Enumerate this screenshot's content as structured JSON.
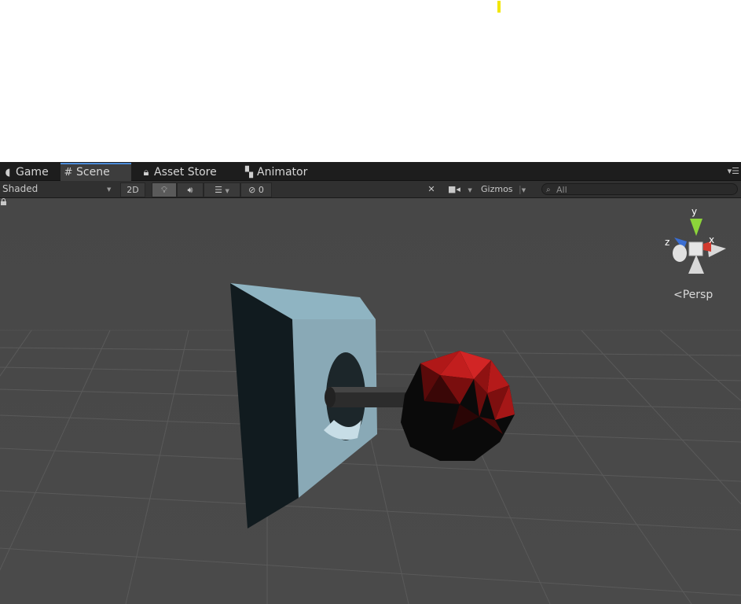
{
  "tabs": [
    {
      "label": "Game",
      "icon": "game-pacman-icon"
    },
    {
      "label": "Scene",
      "icon": "grid-icon",
      "active": true
    },
    {
      "label": "Asset Store",
      "icon": "lock-bag-icon"
    },
    {
      "label": "Animator",
      "icon": "animator-icon"
    }
  ],
  "toolbar": {
    "shading_mode": "Shaded",
    "mode_2d": "2D",
    "hidden_count": "0",
    "gizmos_label": "Gizmos",
    "search_placeholder": "All"
  },
  "viewport": {
    "projection_label": "Persp",
    "axes": {
      "y": "y",
      "x": "x",
      "z": "z"
    }
  },
  "colors": {
    "accent_tab": "#4a8ad8",
    "viewport_bg": "#474747",
    "axis_y": "#8cd43a",
    "axis_x": "#d23a2e",
    "axis_z": "#3a6ed2"
  }
}
